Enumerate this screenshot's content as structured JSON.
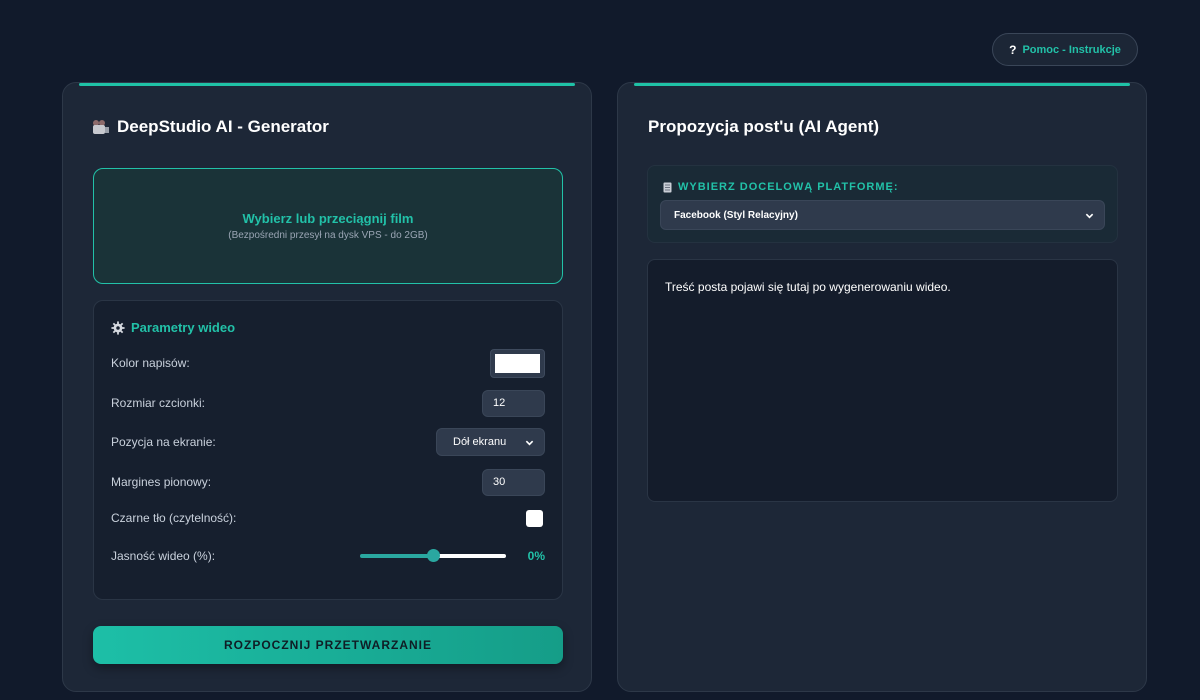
{
  "help": {
    "icon": "question-icon",
    "label": "Pomoc - Instrukcje",
    "mark": "?"
  },
  "left": {
    "title": "DeepStudio AI - Generator",
    "title_icon": "movie-camera-icon",
    "dropzone": {
      "title": "Wybierz lub przeciągnij film",
      "subtitle": "(Bezpośredni przesył na dysk VPS - do 2GB)"
    },
    "params": {
      "title": "Parametry wideo",
      "icon": "gear-icon",
      "text_color": {
        "label": "Kolor napisów:",
        "value": "#ffffff"
      },
      "font_size": {
        "label": "Rozmiar czcionki:",
        "value": "12"
      },
      "position": {
        "label": "Pozycja na ekranie:",
        "value": "Dół ekranu"
      },
      "margin": {
        "label": "Margines pionowy:",
        "value": "30"
      },
      "black_bg": {
        "label": "Czarne tło (czytelność):",
        "checked": false
      },
      "brightness": {
        "label": "Jasność wideo (%):",
        "slider_fraction": 0.5,
        "value_text": "0%"
      }
    },
    "start_button": "ROZPOCZNIJ PRZETWARZANIE"
  },
  "right": {
    "title": "Propozycja post'u (AI Agent)",
    "platform": {
      "label": "WYBIERZ DOCELOWĄ PLATFORMĘ:",
      "icon": "document-icon",
      "selected": "Facebook (Styl Relacyjny)"
    },
    "post_placeholder": "Treść posta pojawi się tutaj po wygenerowaniu wideo."
  },
  "colors": {
    "accent": "#22c1a8",
    "background": "#111a2b",
    "card": "#1d2737"
  }
}
